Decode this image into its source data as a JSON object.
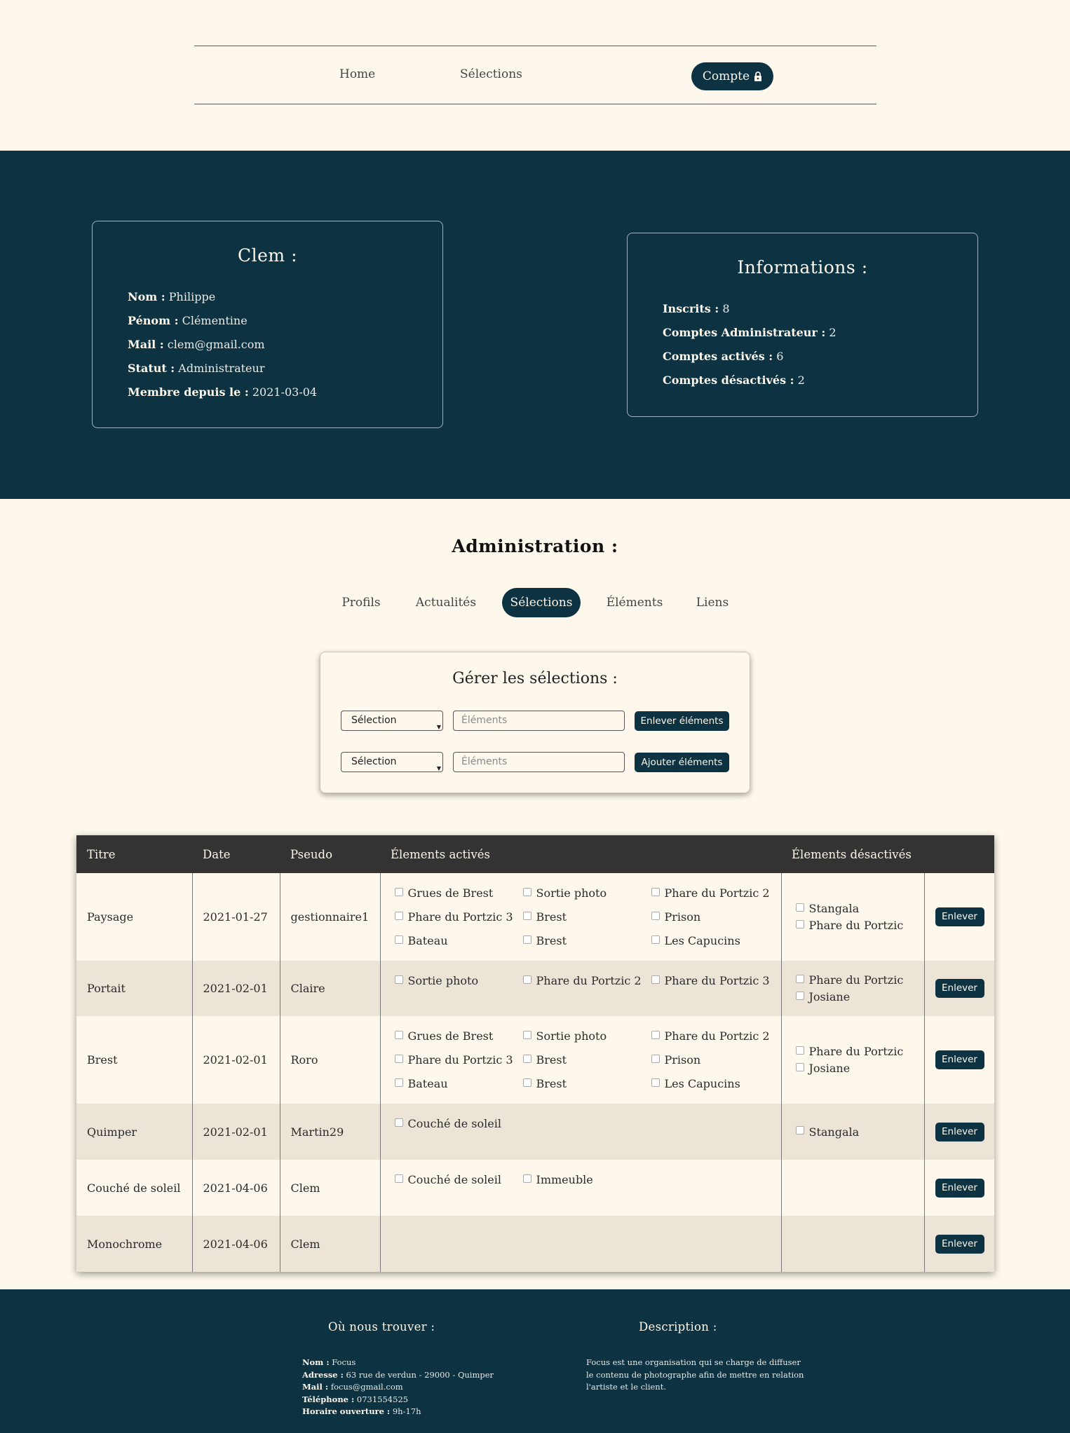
{
  "nav": {
    "home": "Home",
    "selections": "Sélections",
    "account": "Compte",
    "account_icon": "lock-icon"
  },
  "profile": {
    "title": "Clem :",
    "fields": [
      {
        "label": "Nom :",
        "value": " Philippe"
      },
      {
        "label": "Pénom :",
        "value": " Clémentine"
      },
      {
        "label": "Mail :",
        "value": " clem@gmail.com"
      },
      {
        "label": "Statut :",
        "value": " Administrateur"
      },
      {
        "label": "Membre depuis le :",
        "value": " 2021-03-04"
      }
    ]
  },
  "informations": {
    "title": "Informations :",
    "fields": [
      {
        "label": "Inscrits :",
        "value": " 8"
      },
      {
        "label": "Comptes Administrateur :",
        "value": " 2"
      },
      {
        "label": "Comptes activés :",
        "value": " 6"
      },
      {
        "label": "Comptes désactivés :",
        "value": " 2"
      }
    ]
  },
  "admin": {
    "title": "Administration :",
    "tabs": [
      "Profils",
      "Actualités",
      "Sélections",
      "Éléments",
      "Liens"
    ],
    "active_tab": "Sélections"
  },
  "manage": {
    "title": "Gérer les sélections :",
    "row1": {
      "select": "Sélection",
      "placeholder": "Éléments",
      "button": "Enlever éléments"
    },
    "row2": {
      "select": "Sélection",
      "placeholder": "Éléments",
      "button": "Ajouter éléments"
    }
  },
  "table": {
    "headers": [
      "Titre",
      "Date",
      "Pseudo",
      "Élements activés",
      "Élements désactivés",
      ""
    ],
    "remove_label": "Enlever",
    "rows": [
      {
        "titre": "Paysage",
        "date": "2021-01-27",
        "pseudo": "gestionnaire1",
        "actives": [
          "Grues de Brest",
          "Sortie photo",
          "Phare du Portzic 2",
          "Phare du Portzic 3",
          "Brest",
          "Prison",
          "Bateau",
          "Brest",
          "Les Capucins"
        ],
        "desactives": [
          "Stangala",
          "Phare du Portzic"
        ]
      },
      {
        "titre": "Portait",
        "date": "2021-02-01",
        "pseudo": "Claire",
        "actives": [
          "Sortie photo",
          "Phare du Portzic 2",
          "Phare du Portzic 3"
        ],
        "desactives": [
          "Phare du Portzic",
          "Josiane"
        ]
      },
      {
        "titre": "Brest",
        "date": "2021-02-01",
        "pseudo": "Roro",
        "actives": [
          "Grues de Brest",
          "Sortie photo",
          "Phare du Portzic 2",
          "Phare du Portzic 3",
          "Brest",
          "Prison",
          "Bateau",
          "Brest",
          "Les Capucins"
        ],
        "desactives": [
          "Phare du Portzic",
          "Josiane"
        ]
      },
      {
        "titre": "Quimper",
        "date": "2021-02-01",
        "pseudo": "Martin29",
        "actives": [
          "Couché de soleil"
        ],
        "desactives": [
          "Stangala"
        ]
      },
      {
        "titre": "Couché de soleil",
        "date": "2021-04-06",
        "pseudo": "Clem",
        "actives": [
          "Couché de soleil",
          "Immeuble"
        ],
        "desactives": []
      },
      {
        "titre": "Monochrome",
        "date": "2021-04-06",
        "pseudo": "Clem",
        "actives": [],
        "desactives": []
      }
    ]
  },
  "footer": {
    "where_title": "Où nous trouver :",
    "where": [
      {
        "label": "Nom :",
        "value": " Focus"
      },
      {
        "label": "Adresse :",
        "value": " 63 rue de verdun - 29000 - Quimper"
      },
      {
        "label": "Mail :",
        "value": " focus@gmail.com"
      },
      {
        "label": "Téléphone :",
        "value": " 0731554525"
      },
      {
        "label": "Horaire ouverture :",
        "value": " 9h-17h"
      }
    ],
    "desc_title": "Description :",
    "desc_lines": [
      "Focus est une organisation qui se charge de diffuser",
      "le contenu de photographe afin de mettre en relation",
      "l'artiste et le client."
    ]
  },
  "colors": {
    "background": "#fdf8eb",
    "primary": "#0d3242",
    "table_header": "#333333",
    "row_alt": "#ebe4d7"
  }
}
